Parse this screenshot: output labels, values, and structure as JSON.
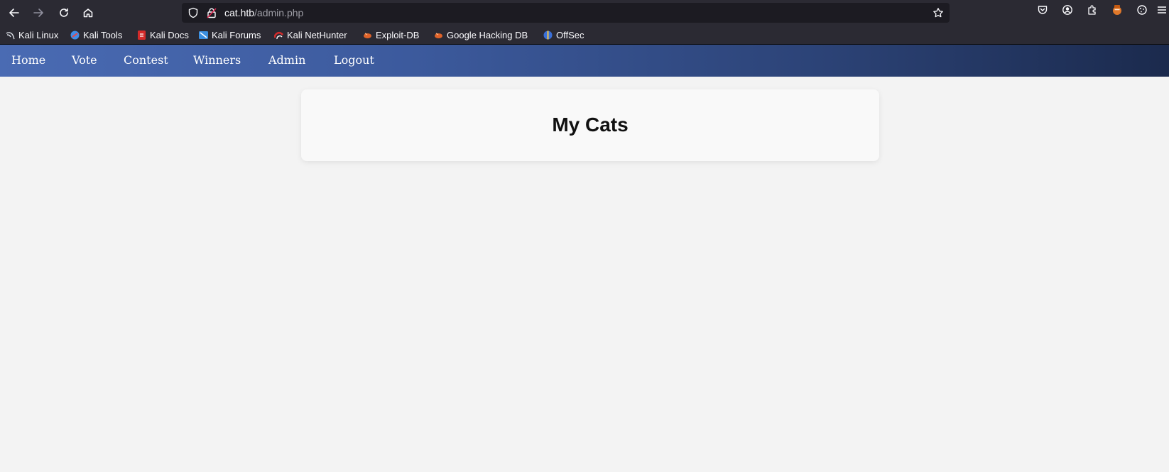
{
  "browser": {
    "url_host": "cat.htb",
    "url_path": "/admin.php",
    "burp_badge": "Burp"
  },
  "bookmarks": [
    {
      "label": "Kali Linux",
      "icon": "kali-dragon-icon"
    },
    {
      "label": "Kali Tools",
      "icon": "kali-tools-icon"
    },
    {
      "label": "Kali Docs",
      "icon": "kali-docs-icon"
    },
    {
      "label": "Kali Forums",
      "icon": "kali-forums-icon"
    },
    {
      "label": "Kali NetHunter",
      "icon": "kali-nethunter-icon"
    },
    {
      "label": "Exploit-DB",
      "icon": "exploit-db-icon"
    },
    {
      "label": "Google Hacking DB",
      "icon": "google-hacking-db-icon"
    },
    {
      "label": "OffSec",
      "icon": "offsec-icon"
    }
  ],
  "nav": {
    "items": [
      "Home",
      "Vote",
      "Contest",
      "Winners",
      "Admin",
      "Logout"
    ]
  },
  "main": {
    "title": "My Cats"
  },
  "colors": {
    "nav_start": "#4a6bb3",
    "nav_end": "#1b2a4d",
    "page_bg": "#f3f3f3",
    "browser_chrome": "#2b2a33"
  }
}
